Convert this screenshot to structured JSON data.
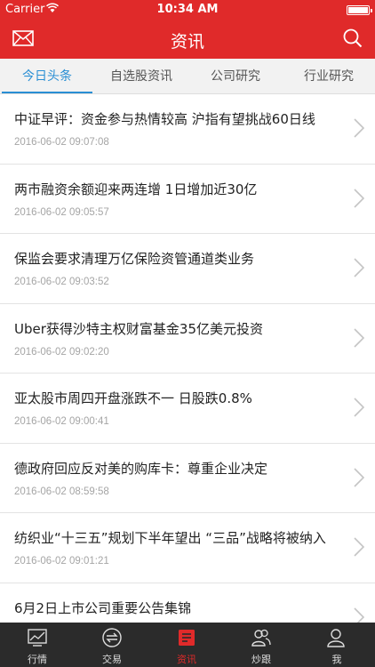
{
  "status": {
    "carrier": "Carrier",
    "time": "10:34 AM"
  },
  "nav": {
    "title": "资讯"
  },
  "tabs": [
    {
      "label": "今日头条"
    },
    {
      "label": "自选股资讯"
    },
    {
      "label": "公司研究"
    },
    {
      "label": "行业研究"
    }
  ],
  "news": [
    {
      "title": "中证早评：资金参与热情较高 沪指有望挑战60日线",
      "date": "2016-06-02 09:07:08"
    },
    {
      "title": "两市融资余额迎来两连增 1日增加近30亿",
      "date": "2016-06-02 09:05:57"
    },
    {
      "title": "保监会要求清理万亿保险资管通道类业务",
      "date": "2016-06-02 09:03:52"
    },
    {
      "title": "Uber获得沙特主权财富基金35亿美元投资",
      "date": "2016-06-02 09:02:20"
    },
    {
      "title": "亚太股市周四开盘涨跌不一 日股跌0.8%",
      "date": "2016-06-02 09:00:41"
    },
    {
      "title": "德政府回应反对美的购库卡：尊重企业决定",
      "date": "2016-06-02 08:59:58"
    },
    {
      "title": "纺织业“十三五”规划下半年望出 “三品”战略将被纳入",
      "date": "2016-06-02 09:01:21"
    },
    {
      "title": "6月2日上市公司重要公告集锦",
      "date": ""
    }
  ],
  "tabbar": [
    {
      "label": "行情"
    },
    {
      "label": "交易"
    },
    {
      "label": "资讯"
    },
    {
      "label": "炒跟"
    },
    {
      "label": "我"
    }
  ],
  "colors": {
    "brand_red": "#e02a2a",
    "tab_active_blue": "#2a8fd4",
    "tabbar_bg": "#2b2b2b"
  }
}
